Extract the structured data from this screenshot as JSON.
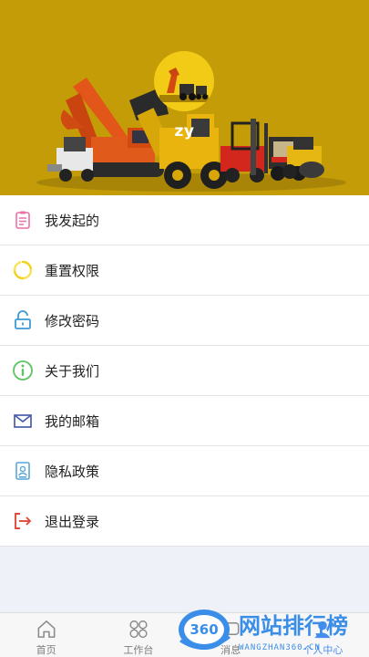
{
  "profile": {
    "username": "zy"
  },
  "colors": {
    "banner": "#c39c08",
    "avatar_bg": "#f2cb16",
    "active_tab": "#4a8df0"
  },
  "menu": {
    "items": [
      {
        "label": "我发起的",
        "icon": "clipboard-icon"
      },
      {
        "label": "重置权限",
        "icon": "refresh-icon"
      },
      {
        "label": "修改密码",
        "icon": "unlock-icon"
      },
      {
        "label": "关于我们",
        "icon": "info-icon"
      },
      {
        "label": "我的邮箱",
        "icon": "mail-icon"
      },
      {
        "label": "隐私政策",
        "icon": "privacy-doc-icon"
      },
      {
        "label": "退出登录",
        "icon": "logout-icon"
      }
    ]
  },
  "tabbar": {
    "tabs": [
      {
        "label": "首页",
        "icon": "home-icon"
      },
      {
        "label": "工作台",
        "icon": "grid-icon"
      },
      {
        "label": "消息",
        "icon": "message-icon"
      },
      {
        "label": "个人中心",
        "icon": "user-icon",
        "active": true
      }
    ]
  },
  "watermark": {
    "logo": "360",
    "title": "网站排行榜",
    "url": "WANGZHAN360.CN"
  }
}
